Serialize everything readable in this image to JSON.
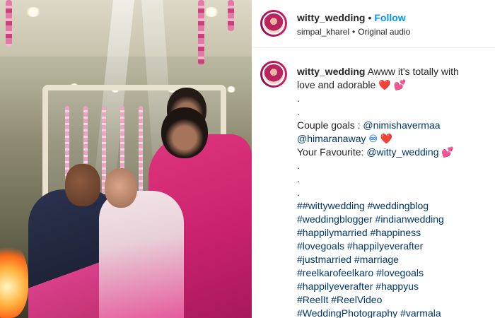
{
  "post": {
    "username": "witty_wedding",
    "separator": "•",
    "follow_label": "Follow",
    "audio_user": "simpal_kharel",
    "audio_label": "Original audio"
  },
  "caption": {
    "username": "witty_wedding",
    "intro": "Awww it's totally with love and adorable",
    "heart": "❤️",
    "sparkle_heart": "💕",
    "dot": ".",
    "couple_goals_label": "Couple goals :",
    "mention_1": "@nimishavermaa",
    "mention_2": "@himaranaway",
    "infinity": "♾",
    "favourite_label": "Your Favourite:",
    "mention_3": "@witty_wedding",
    "hashtag_lines": [
      "##wittywedding #weddingblog",
      "#weddingblogger #indianwedding",
      "#happilymarried #happiness",
      "#lovegoals #happilyeverafter",
      "#justmarried #marriage",
      "#reelkarofeelkaro #lovegoals",
      "#happilyeverafter #happyus",
      "#ReelIt #ReelVideo",
      "#WeddingPhotography #varmala"
    ]
  },
  "colors": {
    "link_blue": "#0095f6",
    "mention_blue": "#00376b",
    "text": "#262626"
  },
  "media": {
    "description_icon": "wedding-photo"
  }
}
